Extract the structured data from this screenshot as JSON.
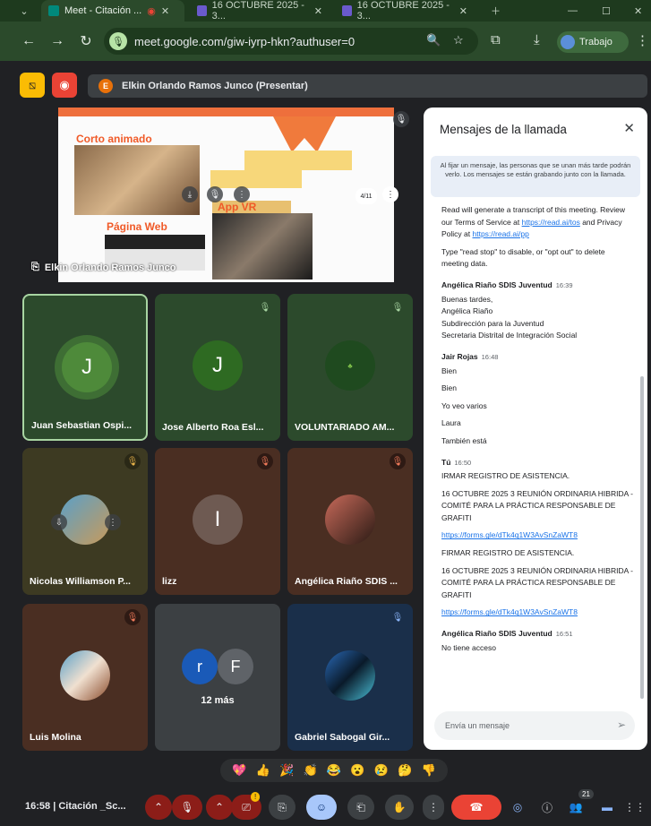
{
  "browser": {
    "tabs": [
      {
        "label": "Meet - Citación ..."
      },
      {
        "label": "16 OCTUBRE 2025 - 3..."
      },
      {
        "label": "16 OCTUBRE 2025 - 3..."
      }
    ],
    "url": "meet.google.com/giw-iyrp-hkn?authuser=0",
    "profile": "Trabajo"
  },
  "meet": {
    "presenter_banner": "Elkin Orlando Ramos Junco (Presentar)",
    "presenter_initial": "E",
    "presentation": {
      "presenter_name": "Elkin Orlando Ramos Junco",
      "slide_title_1": "Corto animado",
      "slide_title_2": "Página Web",
      "slide_title_3": "App VR",
      "page_indicator": "4/11"
    },
    "tiles": [
      {
        "name": "Juan Sebastian Ospi...",
        "initial": "J"
      },
      {
        "name": "Jose Alberto Roa Esl...",
        "initial": "J"
      },
      {
        "name": "VOLUNTARIADO AM...",
        "initial": ""
      },
      {
        "name": "Nicolas Williamson P...",
        "initial": ""
      },
      {
        "name": "lizz",
        "initial": "I"
      },
      {
        "name": "Angélica Riaño SDIS ...",
        "initial": ""
      },
      {
        "name": "Luis Molina",
        "initial": ""
      },
      {
        "name": "12 más",
        "initial": ""
      },
      {
        "name": "Gabriel Sabogal Gir...",
        "initial": ""
      }
    ],
    "more_initials": [
      "r",
      "F"
    ]
  },
  "chat": {
    "title": "Mensajes de la llamada",
    "pin_note": "Al fijar un mensaje, las personas que se unan más tarde podrán verlo. Los mensajes se están grabando junto con la llamada.",
    "intro": {
      "line1_pre": "Read will generate a transcript of this meeting. Review our Terms of Service at",
      "link1": "https://read.ai/tos",
      "line1_mid": "and Privacy Policy at",
      "link2": "https://read.ai/pp",
      "line2": "Type \"read stop\" to disable, or \"opt out\" to delete meeting data."
    },
    "groups": [
      {
        "author": "Angélica Riaño SDIS Juventud",
        "time": "16:39",
        "lines": [
          "Buenas tardes,",
          "Angélica Riaño",
          "Subdirección para la Juventud",
          "Secretaria Distrital de Integración Social"
        ]
      },
      {
        "author": "Jair Rojas",
        "time": "16:48",
        "lines": [
          "Bien",
          "Bien",
          "Yo veo varios",
          "Laura",
          "También está"
        ]
      },
      {
        "author": "Tú",
        "time": "16:50",
        "lines": [
          "IRMAR REGISTRO DE ASISTENCIA.",
          "16 OCTUBRE 2025 3 REUNIÓN ORDINARIA HIBRIDA - COMITÉ PARA LA PRÁCTICA RESPONSABLE DE GRAFITI",
          "https://forms.gle/dTk4q1W3AvSnZaWT8",
          "FIRMAR REGISTRO DE ASISTENCIA.",
          "16 OCTUBRE 2025 3 REUNIÓN ORDINARIA HIBRIDA - COMITÉ PARA LA PRÁCTICA RESPONSABLE DE GRAFITI",
          "https://forms.gle/dTk4q1W3AvSnZaWT8"
        ]
      },
      {
        "author": "Angélica Riaño SDIS Juventud",
        "time": "16:51",
        "lines": [
          "No tiene acceso"
        ]
      }
    ],
    "input_placeholder": "Envía un mensaje"
  },
  "reactions": [
    "💖",
    "👍",
    "🎉",
    "👏",
    "😂",
    "😮",
    "😢",
    "🤔",
    "👎"
  ],
  "controls": {
    "clock": "16:58",
    "meeting_label": "Citación _Sc...",
    "people_count": "21"
  },
  "colors": {
    "tile_green": "#2c4a2c",
    "tile_brown": "#4a2e22",
    "tile_olive": "#3d3a22",
    "tile_navy": "#1a2f4a",
    "accent_red": "#ea4335"
  }
}
